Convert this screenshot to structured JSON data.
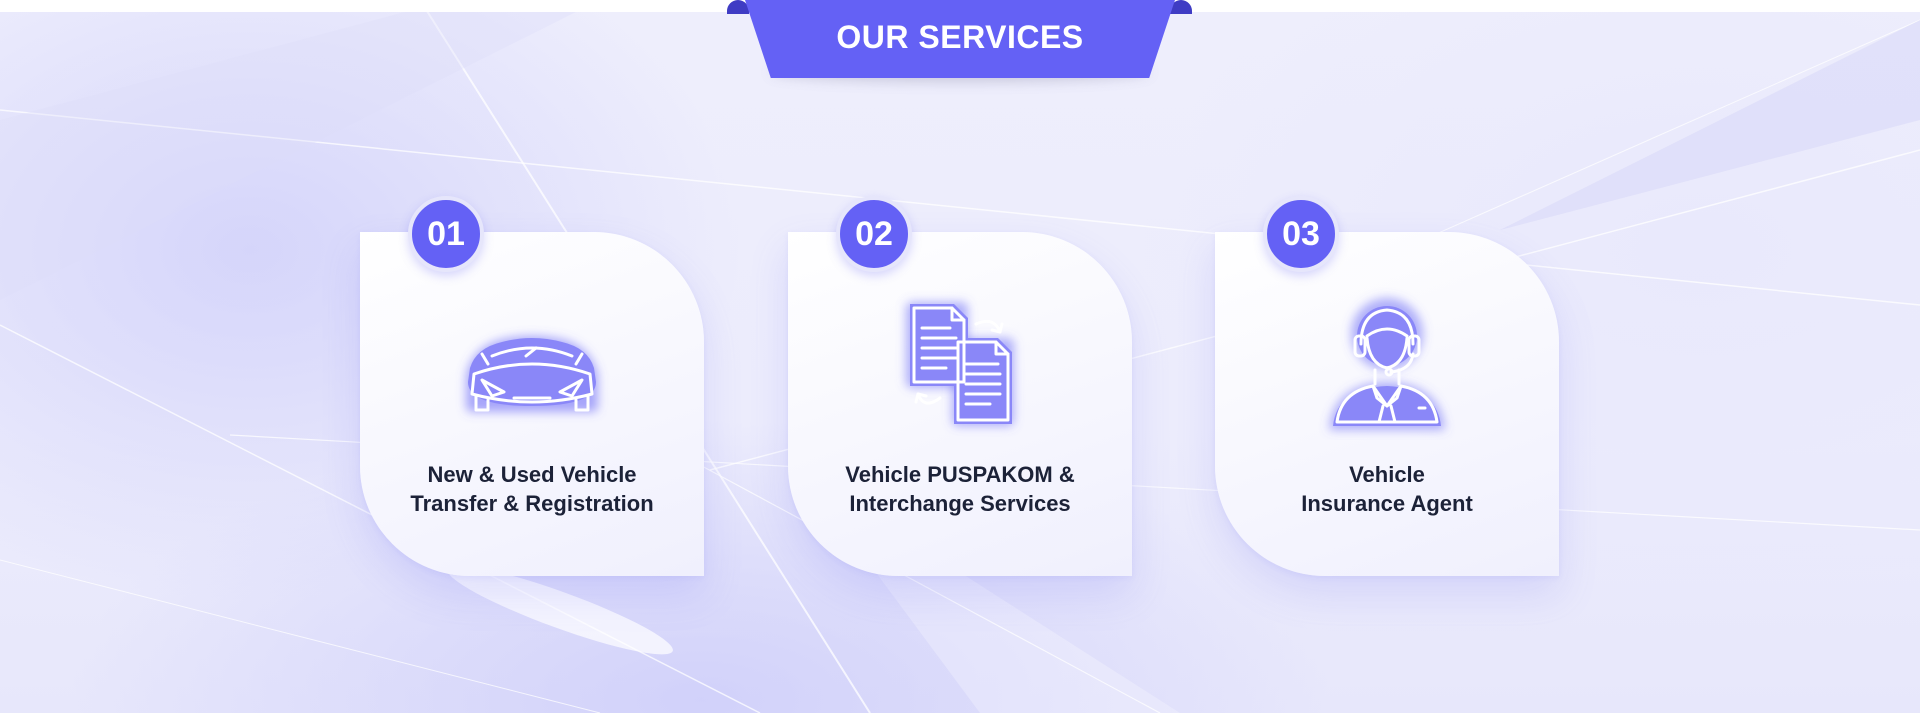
{
  "header": {
    "title": "OUR SERVICES"
  },
  "colors": {
    "accent": "#6461f5",
    "ribbon_fold": "#3f3cc4",
    "text_dark": "#1c2238",
    "background": "#efeffc"
  },
  "services": [
    {
      "number": "01",
      "icon": "car-icon",
      "title_line1": "New & Used Vehicle",
      "title_line2": "Transfer & Registration"
    },
    {
      "number": "02",
      "icon": "document-exchange-icon",
      "title_line1": "Vehicle PUSPAKOM &",
      "title_line2": "Interchange Services"
    },
    {
      "number": "03",
      "icon": "support-agent-icon",
      "title_line1": "Vehicle",
      "title_line2": "Insurance Agent"
    }
  ]
}
